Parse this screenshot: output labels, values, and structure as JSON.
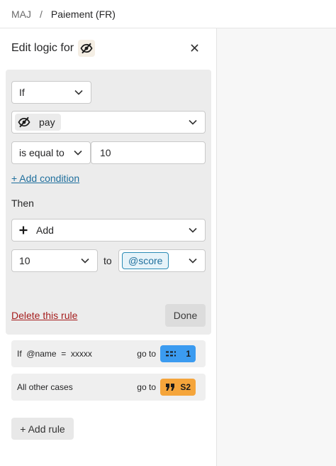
{
  "breadcrumb": {
    "project": "MAJ",
    "separator": "/",
    "page": "Paiement (FR)"
  },
  "panel": {
    "title": "Edit logic for",
    "title_icon": "eye-slash-icon",
    "close_label": "×"
  },
  "rule": {
    "if_select": "If",
    "variable": {
      "icon": "eye-slash-icon",
      "label": "pay"
    },
    "operator": "is equal to",
    "value": "10",
    "add_condition": "+ Add condition",
    "then_label": "Then",
    "action_select": {
      "icon": "plus-icon",
      "label": "Add"
    },
    "action_value": "10",
    "to_label": "to",
    "target_variable": "@score",
    "delete_label": "Delete this rule",
    "done_label": "Done"
  },
  "cases": [
    {
      "condition": "If  @name  =  xxxxx",
      "goto_label": "go to",
      "badge_icon": "equals-icon",
      "badge_value": "1",
      "badge_color": "#3b9bf0"
    },
    {
      "condition": "All other cases",
      "goto_label": "go to",
      "badge_icon": "quote-icon",
      "badge_value": "S2",
      "badge_color": "#f5a53b"
    }
  ],
  "add_rule_label": "+ Add rule",
  "colors": {
    "link": "#1f6f9d",
    "danger": "#a51d1d",
    "rule_bg": "#ececec",
    "right_bg": "#f7f7f7"
  }
}
